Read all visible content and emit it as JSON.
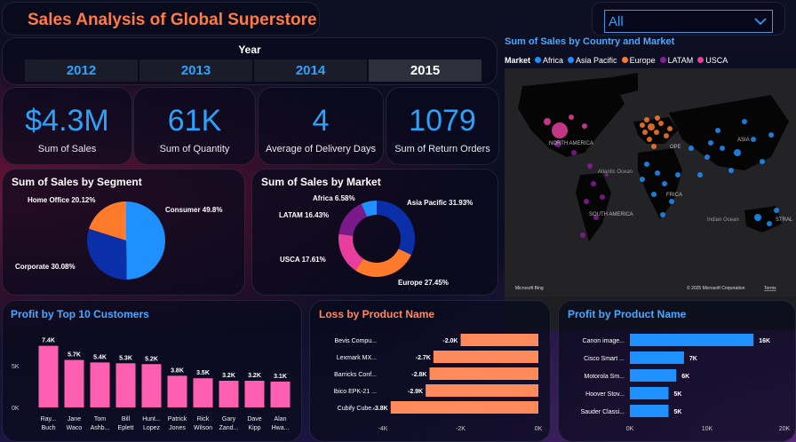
{
  "header": {
    "title": "Sales Analysis of Global Superstore"
  },
  "filter": {
    "selected": "All"
  },
  "year": {
    "label": "Year",
    "options": [
      "2012",
      "2013",
      "2014",
      "2015"
    ],
    "selected": "2015"
  },
  "kpis": [
    {
      "value": "$4.3M",
      "label": "Sum of Sales"
    },
    {
      "value": "61K",
      "label": "Sum of Quantity"
    },
    {
      "value": "4",
      "label": "Average of Delivery Days"
    },
    {
      "value": "1079",
      "label": "Sum of Return Orders"
    }
  ],
  "segment": {
    "title": "Sum of Sales by Segment",
    "slices": [
      {
        "label": "Consumer 49.8%",
        "value": 49.8,
        "color": "#1e90ff"
      },
      {
        "label": "Corporate 30.08%",
        "value": 30.08,
        "color": "#0b2fa8"
      },
      {
        "label": "Home Office 20.12%",
        "value": 20.12,
        "color": "#ff7a2a"
      }
    ]
  },
  "market": {
    "title": "Sum of Sales by Market",
    "slices": [
      {
        "label": "Asia Pacific 31.93%",
        "value": 31.93,
        "color": "#0b2fa8"
      },
      {
        "label": "Europe 27.45%",
        "value": 27.45,
        "color": "#ff7a2a"
      },
      {
        "label": "USCA 17.61%",
        "value": 17.61,
        "color": "#e83e9e"
      },
      {
        "label": "LATAM 16.43%",
        "value": 16.43,
        "color": "#7a1a8a"
      },
      {
        "label": "Africa 6.58%",
        "value": 6.58,
        "color": "#1e90ff"
      }
    ]
  },
  "map": {
    "title": "Sum of Sales by Country and Market",
    "legend_title": "Market",
    "legend": [
      {
        "name": "Africa",
        "color": "#1e90ff"
      },
      {
        "name": "Asia Pacific",
        "color": "#1e90ff"
      },
      {
        "name": "Europe",
        "color": "#ff7a2a"
      },
      {
        "name": "LATAM",
        "color": "#8a1a9a"
      },
      {
        "name": "USCA",
        "color": "#e83e9e"
      }
    ],
    "labels": {
      "north_america": "NORTH AMERICA",
      "europe": "OPE",
      "asia": "ASIA",
      "atlantic": "Atlantic Ocean",
      "africa": "FRICA",
      "south_america": "SOUTH AMERICA",
      "indian": "Indian Ocean",
      "stral": "STRAL"
    },
    "attribution": "Microsoft Bing",
    "copyright": "© 2025 Microsoft Corporation",
    "terms": "Terms"
  },
  "chart_data": [
    {
      "type": "bar",
      "title": "Profit by Top 10 Customers",
      "categories": [
        "Ray... Buch",
        "Jane Waco",
        "Tom Ashb...",
        "Bill Eplett",
        "Hunt... Lopez",
        "Patrick Jones",
        "Rick Wilson",
        "Gary Zand...",
        "Dave Kipp",
        "Alan Hwa..."
      ],
      "category_lines": [
        [
          "Ray...",
          "Buch"
        ],
        [
          "Jane",
          "Waco"
        ],
        [
          "Tom",
          "Ashb..."
        ],
        [
          "Bill",
          "Eplett"
        ],
        [
          "Hunt...",
          "Lopez"
        ],
        [
          "Patrick",
          "Jones"
        ],
        [
          "Rick",
          "Wilson"
        ],
        [
          "Gary",
          "Zand..."
        ],
        [
          "Dave",
          "Kipp"
        ],
        [
          "Alan",
          "Hwa..."
        ]
      ],
      "values": [
        7400,
        5700,
        5400,
        5300,
        5200,
        3800,
        3500,
        3200,
        3200,
        3100
      ],
      "data_labels": [
        "7.4K",
        "5.7K",
        "5.4K",
        "5.3K",
        "5.2K",
        "3.8K",
        "3.5K",
        "3.2K",
        "3.2K",
        "3.1K"
      ],
      "yticks": [
        "0K",
        "5K"
      ],
      "ylim": [
        0,
        8000
      ],
      "color": "#ff5fb0"
    },
    {
      "type": "bar",
      "orientation": "horizontal",
      "title": "Loss by Product Name",
      "categories": [
        "Bevis Compu...",
        "Lexmark MX...",
        "Barricks Conf...",
        "Ibico EPK-21 ...",
        "Cubify Cube..."
      ],
      "values": [
        -2000,
        -2700,
        -2800,
        -2900,
        -3800
      ],
      "data_labels": [
        "-2.0K",
        "-2.7K",
        "-2.8K",
        "-2.9K",
        "-3.8K"
      ],
      "xticks": [
        "-4K",
        "-2K",
        "0K"
      ],
      "xlim": [
        -4000,
        0
      ],
      "color": "#ff8a5c"
    },
    {
      "type": "bar",
      "orientation": "horizontal",
      "title": "Profit by Product Name",
      "categories": [
        "Canon image...",
        "Cisco Smart ...",
        "Motorola Sm...",
        "Hoover Stov...",
        "Sauder Classi..."
      ],
      "values": [
        16000,
        7000,
        6000,
        5000,
        5000
      ],
      "data_labels": [
        "16K",
        "7K",
        "6K",
        "5K",
        "5K"
      ],
      "xticks": [
        "0K",
        "10K",
        "20K"
      ],
      "xlim": [
        0,
        20000
      ],
      "color": "#1e90ff"
    }
  ]
}
